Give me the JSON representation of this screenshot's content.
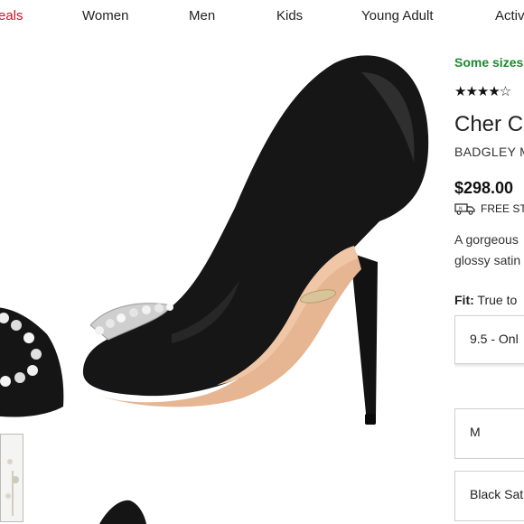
{
  "nav": {
    "items": [
      "eals",
      "Women",
      "Men",
      "Kids",
      "Young Adult",
      "Activ"
    ]
  },
  "product": {
    "availability": "Some sizes",
    "rating_stars": "★★★★☆",
    "title": "Cher C",
    "brand": "BADGLEY M",
    "price": "$298.00",
    "shipping": "FREE STA",
    "description_line1": "A gorgeous",
    "description_line2": "glossy satin",
    "fit_label": "Fit:",
    "fit_value": "True to",
    "size_selected": "9.5 - Onl",
    "width_selected": "M",
    "color_selected": "Black Sat"
  },
  "colors": {
    "accent_red": "#d0112b",
    "availability_green": "#1a8a2e",
    "shoe_black": "#141414",
    "sole_tan": "#e3b38f"
  },
  "icons": {
    "shipping": "truck-icon",
    "rating": "star-icon"
  }
}
